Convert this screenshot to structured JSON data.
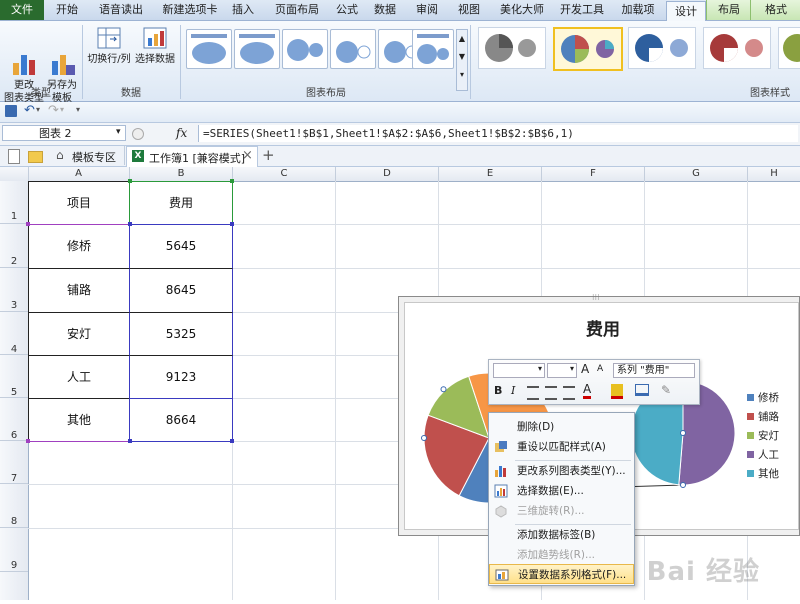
{
  "ribbon_tabs": [
    {
      "label": "文件"
    },
    {
      "label": "开始"
    },
    {
      "label": "语音读出"
    },
    {
      "label": "新建选项卡"
    },
    {
      "label": "插入"
    },
    {
      "label": "页面布局"
    },
    {
      "label": "公式"
    },
    {
      "label": "数据"
    },
    {
      "label": "审阅"
    },
    {
      "label": "视图"
    },
    {
      "label": "美化大师"
    },
    {
      "label": "开发工具"
    },
    {
      "label": "加载项"
    },
    {
      "label": "设计"
    },
    {
      "label": "布局"
    },
    {
      "label": "格式"
    }
  ],
  "ribbon": {
    "change_type": "更改\n图表类型",
    "save_template": "另存为\n模板",
    "group_type": "类型",
    "switch_rowcol": "切换行/列",
    "select_data": "选择数据",
    "group_data": "数据",
    "group_layout": "图表布局",
    "group_styles": "图表样式"
  },
  "namebox": {
    "value": "图表 2"
  },
  "formula": {
    "fx": "fx",
    "value": "=SERIES(Sheet1!$B$1,Sheet1!$A$2:$A$6,Sheet1!$B$2:$B$6,1)"
  },
  "doctabs": {
    "template_zone": "模板专区",
    "workbook": "工作簿1 [兼容模式]",
    "close": "×",
    "add": "+"
  },
  "columns": [
    "A",
    "B",
    "C",
    "D",
    "E",
    "F",
    "G",
    "H"
  ],
  "rows": [
    "1",
    "2",
    "3",
    "4",
    "5",
    "6",
    "7",
    "8",
    "9"
  ],
  "table": {
    "header": [
      "项目",
      "费用"
    ],
    "rows": [
      [
        "修桥",
        "5645"
      ],
      [
        "铺路",
        "8645"
      ],
      [
        "安灯",
        "5325"
      ],
      [
        "人工",
        "9123"
      ],
      [
        "其他",
        "8664"
      ]
    ]
  },
  "chart_data": {
    "type": "pie",
    "title": "费用",
    "categories": [
      "修桥",
      "铺路",
      "安灯",
      "人工",
      "其他"
    ],
    "values": [
      5645,
      8645,
      5325,
      9123,
      8664
    ],
    "colors": [
      "#4f81bd",
      "#c0504d",
      "#9bbb59",
      "#8064a2",
      "#4bacc6"
    ],
    "legend": "right"
  },
  "mini_toolbar": {
    "series_select": "系列 \"费用\"",
    "bold": "B",
    "italic": "I",
    "grow": "A",
    "shrink": "A",
    "fontcolor": "A"
  },
  "context_menu": [
    {
      "label": "删除(D)",
      "enabled": true,
      "icon": ""
    },
    {
      "label": "重设以匹配样式(A)",
      "enabled": true,
      "icon": "reset-style-icon"
    },
    {
      "label": "更改系列图表类型(Y)...",
      "enabled": true,
      "icon": "chart-type-icon"
    },
    {
      "label": "选择数据(E)...",
      "enabled": true,
      "icon": "select-data-icon"
    },
    {
      "label": "三维旋转(R)...",
      "enabled": false,
      "icon": "rotate-3d-icon"
    },
    {
      "label": "添加数据标签(B)",
      "enabled": true,
      "icon": ""
    },
    {
      "label": "添加趋势线(R)...",
      "enabled": false,
      "icon": ""
    },
    {
      "label": "设置数据系列格式(F)...",
      "enabled": true,
      "icon": "format-series-icon"
    }
  ],
  "watermark": "Bai 经验"
}
